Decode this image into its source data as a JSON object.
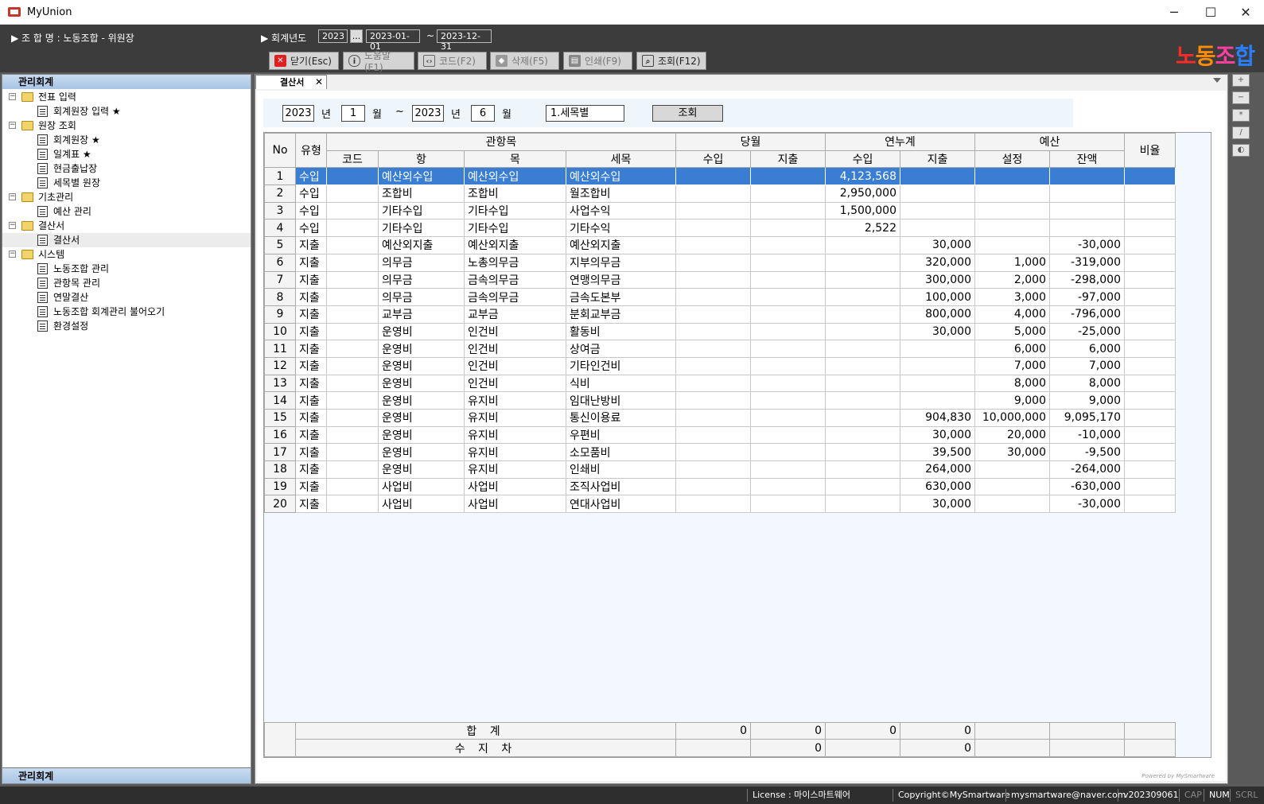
{
  "window": {
    "title": "MyUnion",
    "minimize": "─",
    "maximize": "☐",
    "close": "✕"
  },
  "header": {
    "union_label": "▶  조 합 명 : 노동조합 - 위원장",
    "fiscal_label": "▶ 회계년도",
    "fiscal_year": "2023",
    "fiscal_dots": "...",
    "fiscal_start": "2023-01-01",
    "fiscal_tilde": "~",
    "fiscal_end": "2023-12-31",
    "logo": [
      "노",
      "동",
      "조",
      "합"
    ]
  },
  "toolbar": {
    "close": "닫기(Esc)",
    "help": "도움말(F1)",
    "code": "코드(F2)",
    "delete": "삭제(F5)",
    "print": "인쇄(F9)",
    "query": "조회(F12)"
  },
  "sidebar": {
    "title": "관리회계",
    "footer": "관리회계",
    "folders": [
      {
        "label": "전표 입력",
        "items": [
          "회계원장 입력 ★"
        ]
      },
      {
        "label": "원장 조회",
        "items": [
          "회계원장 ★",
          "일계표 ★",
          "현금출납장",
          "세목별 원장"
        ]
      },
      {
        "label": "기초관리",
        "items": [
          "예산 관리"
        ]
      },
      {
        "label": "결산서",
        "items": [
          "결산서"
        ]
      },
      {
        "label": "시스템",
        "items": [
          "노동조합 관리",
          "관항목 관리",
          "연말결산",
          "노동조합 회계관리 불어오기",
          "환경설정"
        ]
      }
    ]
  },
  "tab": {
    "label": "결산서",
    "close": "✕"
  },
  "filter": {
    "year_from": "2023",
    "year_unit": "년",
    "month_from": "1",
    "month_unit": "월",
    "tilde": "~",
    "year_to": "2023",
    "year_unit2": "년",
    "month_to": "6",
    "month_unit2": "월",
    "mode": "1.세목별",
    "query_button": "조회"
  },
  "grid": {
    "headers": {
      "no": "No",
      "type": "유형",
      "group_account": "관항목",
      "group_month": "당월",
      "group_cumulative": "연누계",
      "group_budget": "예산",
      "ratio": "비율",
      "code": "코드",
      "hang": "항",
      "mok": "목",
      "semok": "세목",
      "m_income": "수입",
      "m_expense": "지출",
      "c_income": "수입",
      "c_expense": "지출",
      "b_set": "설정",
      "b_remain": "잔액"
    },
    "rows": [
      [
        "1",
        "수입",
        "",
        "예산외수입",
        "예산외수입",
        "예산외수입",
        "",
        "",
        "4,123,568",
        "",
        "",
        "",
        ""
      ],
      [
        "2",
        "수입",
        "",
        "조합비",
        "조합비",
        "월조합비",
        "",
        "",
        "2,950,000",
        "",
        "",
        "",
        ""
      ],
      [
        "3",
        "수입",
        "",
        "기타수입",
        "기타수입",
        "사업수익",
        "",
        "",
        "1,500,000",
        "",
        "",
        "",
        ""
      ],
      [
        "4",
        "수입",
        "",
        "기타수입",
        "기타수입",
        "기타수익",
        "",
        "",
        "2,522",
        "",
        "",
        "",
        ""
      ],
      [
        "5",
        "지출",
        "",
        "예산외지출",
        "예산외지출",
        "예산외지출",
        "",
        "",
        "",
        "30,000",
        "",
        "-30,000",
        ""
      ],
      [
        "6",
        "지출",
        "",
        "의무금",
        "노총의무금",
        "지부의무금",
        "",
        "",
        "",
        "320,000",
        "1,000",
        "-319,000",
        ""
      ],
      [
        "7",
        "지출",
        "",
        "의무금",
        "금속의무금",
        "연맹의무금",
        "",
        "",
        "",
        "300,000",
        "2,000",
        "-298,000",
        ""
      ],
      [
        "8",
        "지출",
        "",
        "의무금",
        "금속의무금",
        "금속도본부",
        "",
        "",
        "",
        "100,000",
        "3,000",
        "-97,000",
        ""
      ],
      [
        "9",
        "지출",
        "",
        "교부금",
        "교부금",
        "분회교부금",
        "",
        "",
        "",
        "800,000",
        "4,000",
        "-796,000",
        ""
      ],
      [
        "10",
        "지출",
        "",
        "운영비",
        "인건비",
        "활동비",
        "",
        "",
        "",
        "30,000",
        "5,000",
        "-25,000",
        ""
      ],
      [
        "11",
        "지출",
        "",
        "운영비",
        "인건비",
        "상여금",
        "",
        "",
        "",
        "",
        "6,000",
        "6,000",
        ""
      ],
      [
        "12",
        "지출",
        "",
        "운영비",
        "인건비",
        "기타인건비",
        "",
        "",
        "",
        "",
        "7,000",
        "7,000",
        ""
      ],
      [
        "13",
        "지출",
        "",
        "운영비",
        "인건비",
        "식비",
        "",
        "",
        "",
        "",
        "8,000",
        "8,000",
        ""
      ],
      [
        "14",
        "지출",
        "",
        "운영비",
        "유지비",
        "임대난방비",
        "",
        "",
        "",
        "",
        "9,000",
        "9,000",
        ""
      ],
      [
        "15",
        "지출",
        "",
        "운영비",
        "유지비",
        "통신이용료",
        "",
        "",
        "",
        "904,830",
        "10,000,000",
        "9,095,170",
        ""
      ],
      [
        "16",
        "지출",
        "",
        "운영비",
        "유지비",
        "우편비",
        "",
        "",
        "",
        "30,000",
        "20,000",
        "-10,000",
        ""
      ],
      [
        "17",
        "지출",
        "",
        "운영비",
        "유지비",
        "소모품비",
        "",
        "",
        "",
        "39,500",
        "30,000",
        "-9,500",
        ""
      ],
      [
        "18",
        "지출",
        "",
        "운영비",
        "유지비",
        "인쇄비",
        "",
        "",
        "",
        "264,000",
        "",
        "-264,000",
        ""
      ],
      [
        "19",
        "지출",
        "",
        "사업비",
        "사업비",
        "조직사업비",
        "",
        "",
        "",
        "630,000",
        "",
        "-630,000",
        ""
      ],
      [
        "20",
        "지출",
        "",
        "사업비",
        "사업비",
        "연대사업비",
        "",
        "",
        "",
        "30,000",
        "",
        "-30,000",
        ""
      ]
    ],
    "selected_row": 0,
    "footer": {
      "total_label": "합 계",
      "diff_label": "수 지 차",
      "total": [
        "0",
        "0",
        "0",
        "0"
      ],
      "diff": [
        "0",
        "0"
      ]
    }
  },
  "powered_by": "Powered by MySmartware",
  "side_buttons": [
    "+",
    "−",
    "*",
    "/",
    "◐"
  ],
  "status": {
    "license": "License : 마이스마트웨어",
    "copyright": "Copyright©MySmartware",
    "email": "mysmartware@naver.com",
    "version": "v202309061",
    "cap": "CAP",
    "num": "NUM",
    "scrl": "SCRL"
  },
  "colors": {
    "header_bg": "#3c3c3c",
    "selection": "#3a7ed4",
    "grid_bg": "#f2f8fd"
  }
}
